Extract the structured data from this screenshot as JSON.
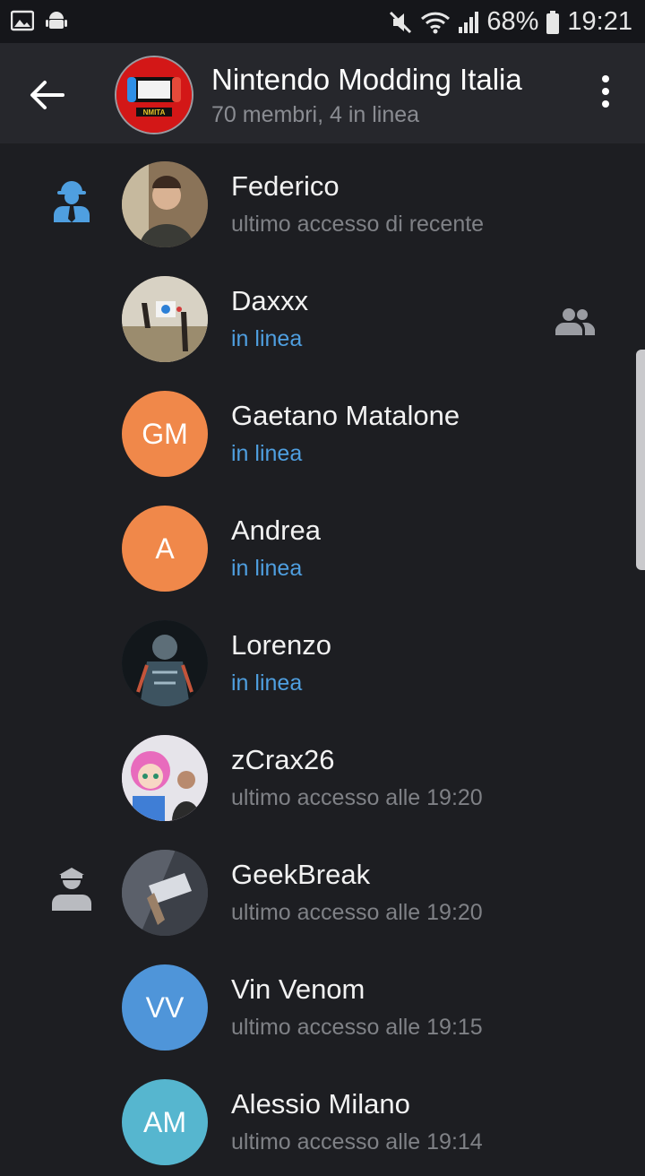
{
  "status_bar": {
    "battery": "68%",
    "time": "19:21"
  },
  "header": {
    "title": "Nintendo Modding Italia",
    "subtitle": "70 membri, 4 in linea",
    "avatar_text": "NMITA"
  },
  "members": [
    {
      "name": "Federico",
      "status": "ultimo accesso di recente",
      "online": false,
      "role": "admin",
      "avatar_color": "#6b5a48"
    },
    {
      "name": "Daxxx",
      "status": "in linea",
      "online": true,
      "contact": true,
      "avatar_color": "#b7a98f"
    },
    {
      "name": "Gaetano Matalone",
      "status": "in linea",
      "online": true,
      "initials": "GM",
      "avatar_color": "#f0884a"
    },
    {
      "name": "Andrea",
      "status": "in linea",
      "online": true,
      "initials": "A",
      "avatar_color": "#f0884a"
    },
    {
      "name": "Lorenzo",
      "status": "in linea",
      "online": true,
      "avatar_color": "#2a3a44"
    },
    {
      "name": "zCrax26",
      "status": "ultimo accesso alle 19:20",
      "online": false,
      "avatar_color": "#c9a0c8"
    },
    {
      "name": "GeekBreak",
      "status": "ultimo accesso alle 19:20",
      "online": false,
      "role": "moderator",
      "avatar_color": "#4c4f58"
    },
    {
      "name": "Vin Venom",
      "status": "ultimo accesso alle 19:15",
      "online": false,
      "initials": "VV",
      "avatar_color": "#4f95d9"
    },
    {
      "name": "Alessio Milano",
      "status": "ultimo accesso alle 19:14",
      "online": false,
      "initials": "AM",
      "avatar_color": "#56b6cf"
    }
  ],
  "colors": {
    "online": "#4f9fe0",
    "admin_icon": "#4f9fe0",
    "moderator_icon": "#b9bbc0"
  }
}
